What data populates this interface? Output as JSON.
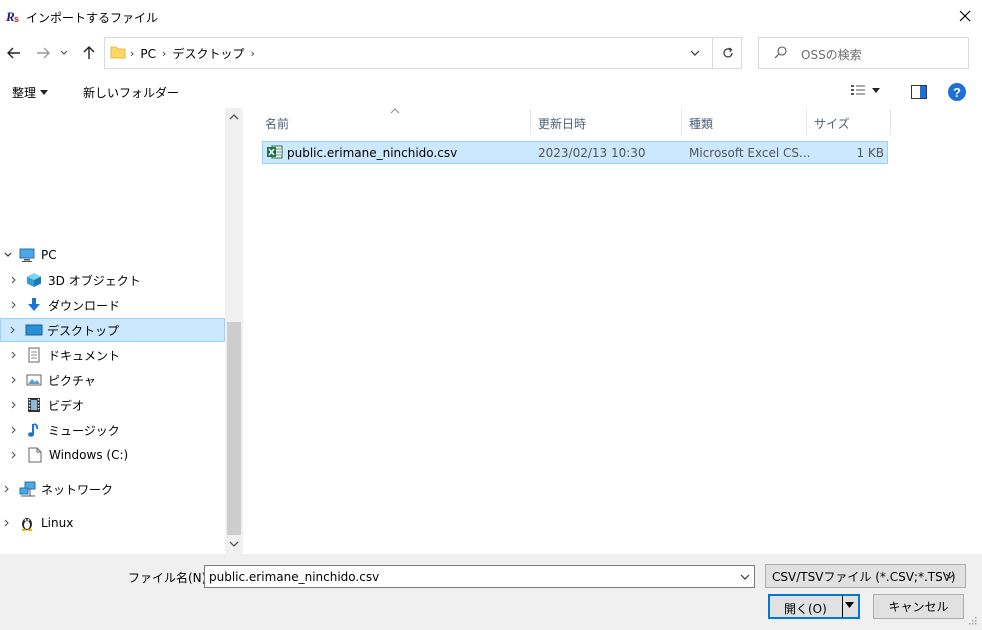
{
  "window": {
    "title": "インポートするファイル",
    "app_icon_text": "Rs"
  },
  "address_bar": {
    "crumbs": [
      "PC",
      "デスクトップ"
    ]
  },
  "search": {
    "placeholder": "OSSの検索"
  },
  "command_bar": {
    "organize_label": "整理",
    "new_folder_label": "新しいフォルダー"
  },
  "nav_tree": {
    "items": [
      {
        "label": "PC",
        "icon": "computer-icon",
        "expanded": true
      },
      {
        "label": "3D オブジェクト",
        "icon": "cube-3d-icon"
      },
      {
        "label": "ダウンロード",
        "icon": "download-arrow-icon"
      },
      {
        "label": "デスクトップ",
        "icon": "desktop-icon",
        "selected": true
      },
      {
        "label": "ドキュメント",
        "icon": "document-icon"
      },
      {
        "label": "ピクチャ",
        "icon": "pictures-icon"
      },
      {
        "label": "ビデオ",
        "icon": "video-icon"
      },
      {
        "label": "ミュージック",
        "icon": "music-note-icon"
      },
      {
        "label": "Windows (C:)",
        "icon": "drive-icon"
      },
      {
        "label": "ネットワーク",
        "icon": "network-icon"
      },
      {
        "label": "Linux",
        "icon": "linux-tux-icon"
      }
    ]
  },
  "file_list": {
    "columns": [
      "名前",
      "更新日時",
      "種類",
      "サイズ"
    ],
    "rows": [
      {
        "name": "public.erimane_ninchido.csv",
        "modified": "2023/02/13 10:30",
        "type": "Microsoft Excel CS...",
        "size": "1 KB",
        "icon": "excel-csv-icon",
        "selected": true
      }
    ]
  },
  "bottom": {
    "filename_label": "ファイル名(N):",
    "filename_value": "public.erimane_ninchido.csv",
    "filter_value": "CSV/TSVファイル (*.CSV;*.TSV)",
    "open_label": "開く(O)",
    "cancel_label": "キャンセル"
  },
  "colors": {
    "selection_bg": "#cce8ff",
    "selection_border": "#99d1ff",
    "accent": "#0078d7",
    "help_blue": "#1e6fd9",
    "folder_yellow": "#ffd766"
  }
}
